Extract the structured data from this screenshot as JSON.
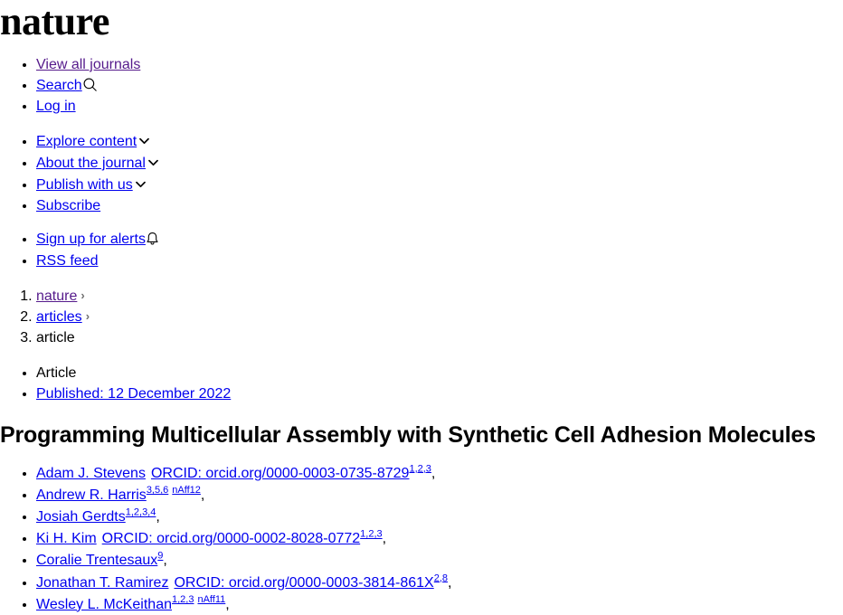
{
  "brand": {
    "logo_text": "nature"
  },
  "nav_primary": [
    {
      "label": "View all journals",
      "visited": true,
      "icon": null
    },
    {
      "label": "Search",
      "visited": false,
      "icon": "search-icon"
    },
    {
      "label": "Log in",
      "visited": false,
      "icon": null
    }
  ],
  "nav_secondary": [
    {
      "label": "Explore content",
      "visited": false,
      "icon": "chevron-down-icon"
    },
    {
      "label": "About the journal",
      "visited": false,
      "icon": "chevron-down-icon"
    },
    {
      "label": "Publish with us",
      "visited": false,
      "icon": "chevron-down-icon"
    },
    {
      "label": "Subscribe",
      "visited": false,
      "icon": null
    }
  ],
  "nav_alerts": [
    {
      "label": "Sign up for alerts",
      "visited": false,
      "icon": "bell-icon"
    },
    {
      "label": "RSS feed",
      "visited": false,
      "icon": null
    }
  ],
  "breadcrumb": [
    {
      "label": "nature",
      "is_link": true,
      "visited": true,
      "separator": "›"
    },
    {
      "label": "articles",
      "is_link": true,
      "visited": false,
      "separator": "›"
    },
    {
      "label": "article",
      "is_link": false,
      "visited": false,
      "separator": ""
    }
  ],
  "article_meta": [
    {
      "label": "Article",
      "is_link": false
    },
    {
      "label": "Published: 12 December 2022",
      "is_link": true
    }
  ],
  "article": {
    "title": "Programming Multicellular Assembly with Synthetic Cell Adhesion Molecules"
  },
  "authors": [
    {
      "name": "Adam J. Stevens",
      "orcid": "ORCID: orcid.org/0000-0003-0735-8729",
      "affiliations": "1,2,3",
      "extra_affiliation": "",
      "trailing": ","
    },
    {
      "name": "Andrew R. Harris",
      "orcid": "",
      "affiliations": "3,5,6",
      "extra_affiliation": "nAff12",
      "trailing": ","
    },
    {
      "name": "Josiah Gerdts",
      "orcid": "",
      "affiliations": "1,2,3,4",
      "extra_affiliation": "",
      "trailing": ","
    },
    {
      "name": "Ki H. Kim",
      "orcid": "ORCID: orcid.org/0000-0002-8028-0772",
      "affiliations": "1,2,3",
      "extra_affiliation": "",
      "trailing": ","
    },
    {
      "name": "Coralie Trentesaux",
      "orcid": "",
      "affiliations": "9",
      "extra_affiliation": "",
      "trailing": ","
    },
    {
      "name": "Jonathan T. Ramirez",
      "orcid": "ORCID: orcid.org/0000-0003-3814-861X",
      "affiliations": "2,8",
      "extra_affiliation": "",
      "trailing": ","
    },
    {
      "name": "Wesley L. McKeithan",
      "orcid": "",
      "affiliations": "1,2,3",
      "extra_affiliation": "nAff11",
      "trailing": ","
    }
  ],
  "colors": {
    "link": "#0000EE",
    "link_visited": "#551A8B",
    "text": "#000000",
    "separator": "#6F6F6F"
  }
}
